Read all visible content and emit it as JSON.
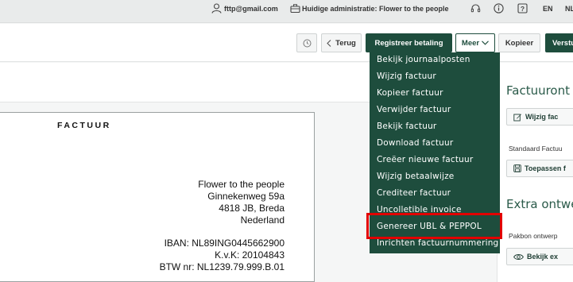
{
  "topbar": {
    "email": "fttp@gmail.com",
    "administration": "Huidige administratie: Flower to the people",
    "language_en": "EN",
    "language_nl": "NL"
  },
  "toolbar": {
    "back_label": "Terug",
    "register_payment_label": "Registreer betaling",
    "more_label": "Meer",
    "copy_label": "Kopieer",
    "send_label": "Verstu"
  },
  "dropdown": {
    "items": [
      "Bekijk journaalposten",
      "Wijzig factuur",
      "Kopieer factuur",
      "Verwijder factuur",
      "Bekijk factuur",
      "Download factuur",
      "Creëer nieuwe factuur",
      "Wijzig betaalwijze",
      "Crediteer factuur",
      "Uncolletible invoice",
      "Genereer UBL & PEPPOL",
      "Inrichten factuurnummering"
    ]
  },
  "invoice": {
    "title": "FACTUUR",
    "company": "Flower to the people",
    "street": "Ginnekenweg 59a",
    "postal_city": "4818 JB, Breda",
    "country": "Nederland",
    "iban": "IBAN: NL89ING0445662900",
    "kvk": "K.v.K: 20104843",
    "btw": "BTW nr: NL1239.79.999.B.01"
  },
  "right_panel": {
    "heading_design": "Factuuront",
    "edit_button": "Wijzig fac",
    "standard_label": "Standaard Factuu",
    "apply_button": "Toepassen f",
    "heading_extra": "Extra ontwe",
    "pakbon_label": "Pakbon ontwerp",
    "view_button": "Bekijk ex"
  },
  "colors": {
    "brand_dark_green": "#1e4d3d",
    "highlight_red": "#e30000"
  }
}
